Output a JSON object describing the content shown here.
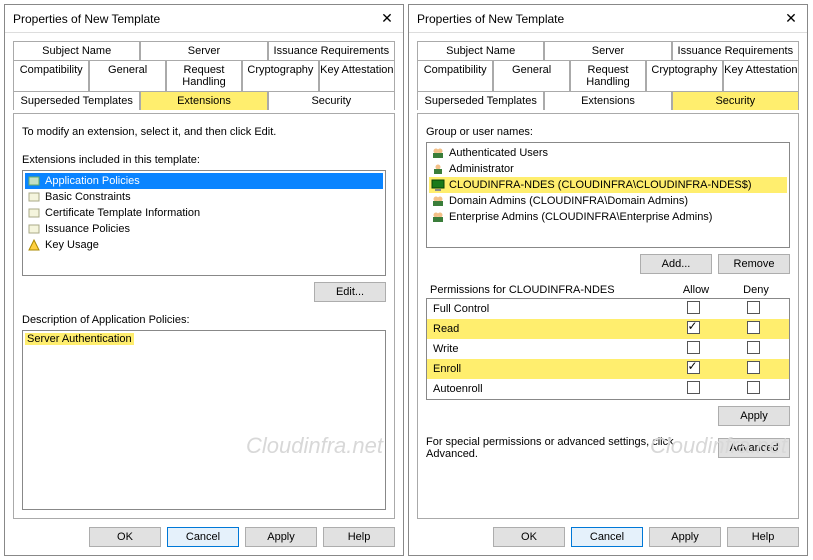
{
  "left": {
    "title": "Properties of New Template",
    "tabs1": [
      "Subject Name",
      "Server",
      "Issuance Requirements"
    ],
    "tabs2": [
      "Compatibility",
      "General",
      "Request Handling",
      "Cryptography",
      "Key Attestation"
    ],
    "tabs3": [
      "Superseded Templates",
      "Extensions",
      "Security"
    ],
    "intro": "To modify an extension, select it, and then click Edit.",
    "list_label": "Extensions included in this template:",
    "items": [
      "Application Policies",
      "Basic Constraints",
      "Certificate Template Information",
      "Issuance Policies",
      "Key Usage"
    ],
    "edit_btn": "Edit...",
    "desc_label": "Description of Application Policies:",
    "desc_text": "Server Authentication",
    "buttons": {
      "ok": "OK",
      "cancel": "Cancel",
      "apply": "Apply",
      "help": "Help"
    },
    "watermark": "Cloudinfra.net"
  },
  "right": {
    "title": "Properties of New Template",
    "tabs1": [
      "Subject Name",
      "Server",
      "Issuance Requirements"
    ],
    "tabs2": [
      "Compatibility",
      "General",
      "Request Handling",
      "Cryptography",
      "Key Attestation"
    ],
    "tabs3": [
      "Superseded Templates",
      "Extensions",
      "Security"
    ],
    "group_label": "Group or user names:",
    "groups": [
      "Authenticated Users",
      "Administrator",
      "CLOUDINFRA-NDES (CLOUDINFRA\\CLOUDINFRA-NDES$)",
      "Domain Admins (CLOUDINFRA\\Domain Admins)",
      "Enterprise Admins (CLOUDINFRA\\Enterprise Admins)"
    ],
    "add_btn": "Add...",
    "remove_btn": "Remove",
    "perm_header": "Permissions for CLOUDINFRA-NDES",
    "allow": "Allow",
    "deny": "Deny",
    "perms": [
      {
        "name": "Full Control",
        "allow": false,
        "deny": false
      },
      {
        "name": "Read",
        "allow": true,
        "deny": false,
        "hl": true
      },
      {
        "name": "Write",
        "allow": false,
        "deny": false
      },
      {
        "name": "Enroll",
        "allow": true,
        "deny": false,
        "hl": true
      },
      {
        "name": "Autoenroll",
        "allow": false,
        "deny": false
      }
    ],
    "apply_btn_row": "Apply",
    "adv_text": "For special permissions or advanced settings, click Advanced.",
    "adv_btn": "Advanced",
    "buttons": {
      "ok": "OK",
      "cancel": "Cancel",
      "apply": "Apply",
      "help": "Help"
    },
    "watermark": "Cloudinfra.net"
  }
}
